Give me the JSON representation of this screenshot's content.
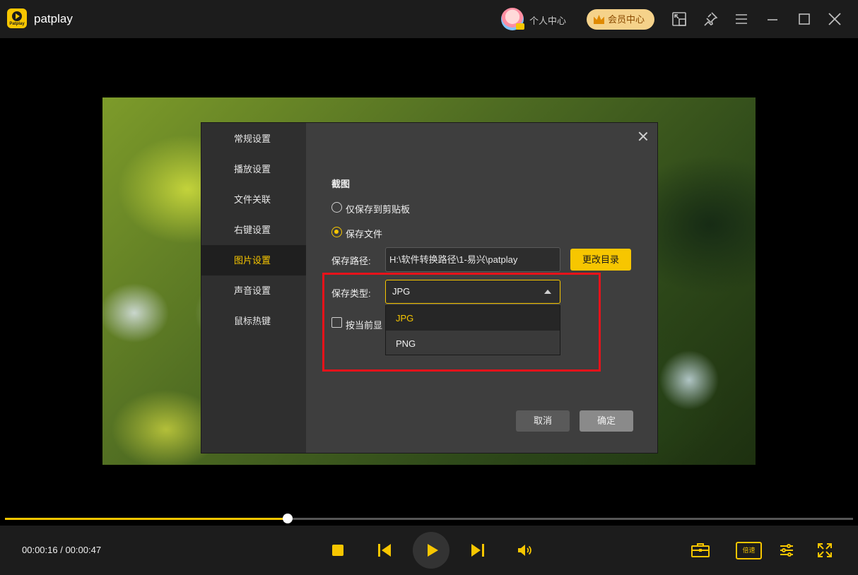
{
  "app": {
    "name": "patplay",
    "logo_text": "Patplay"
  },
  "header": {
    "user_center": "个人中心",
    "vip_center": "会员中心"
  },
  "dialog": {
    "sidebar": [
      {
        "label": "常规设置",
        "active": false
      },
      {
        "label": "播放设置",
        "active": false
      },
      {
        "label": "文件关联",
        "active": false
      },
      {
        "label": "右键设置",
        "active": false
      },
      {
        "label": "图片设置",
        "active": true
      },
      {
        "label": "声音设置",
        "active": false
      },
      {
        "label": "鼠标热键",
        "active": false
      }
    ],
    "section_title": "截图",
    "option_clipboard": "仅保存到剪贴板",
    "option_save_file": "保存文件",
    "save_path_label": "保存路径:",
    "save_path_value": "H:\\软件转换路径\\1-易兴\\patplay",
    "change_dir": "更改目录",
    "save_type_label": "保存类型:",
    "save_type_value": "JPG",
    "dropdown_options": [
      "JPG",
      "PNG"
    ],
    "checkbox_label": "按当前显",
    "cancel": "取消",
    "confirm": "确定"
  },
  "player": {
    "current_time": "00:00:16",
    "total_time": "00:00:47",
    "time_display": "00:00:16 / 00:00:47",
    "progress": 0.333,
    "speed_label": "倍速"
  },
  "colors": {
    "accent": "#f7c600",
    "highlight": "#e8121a"
  }
}
